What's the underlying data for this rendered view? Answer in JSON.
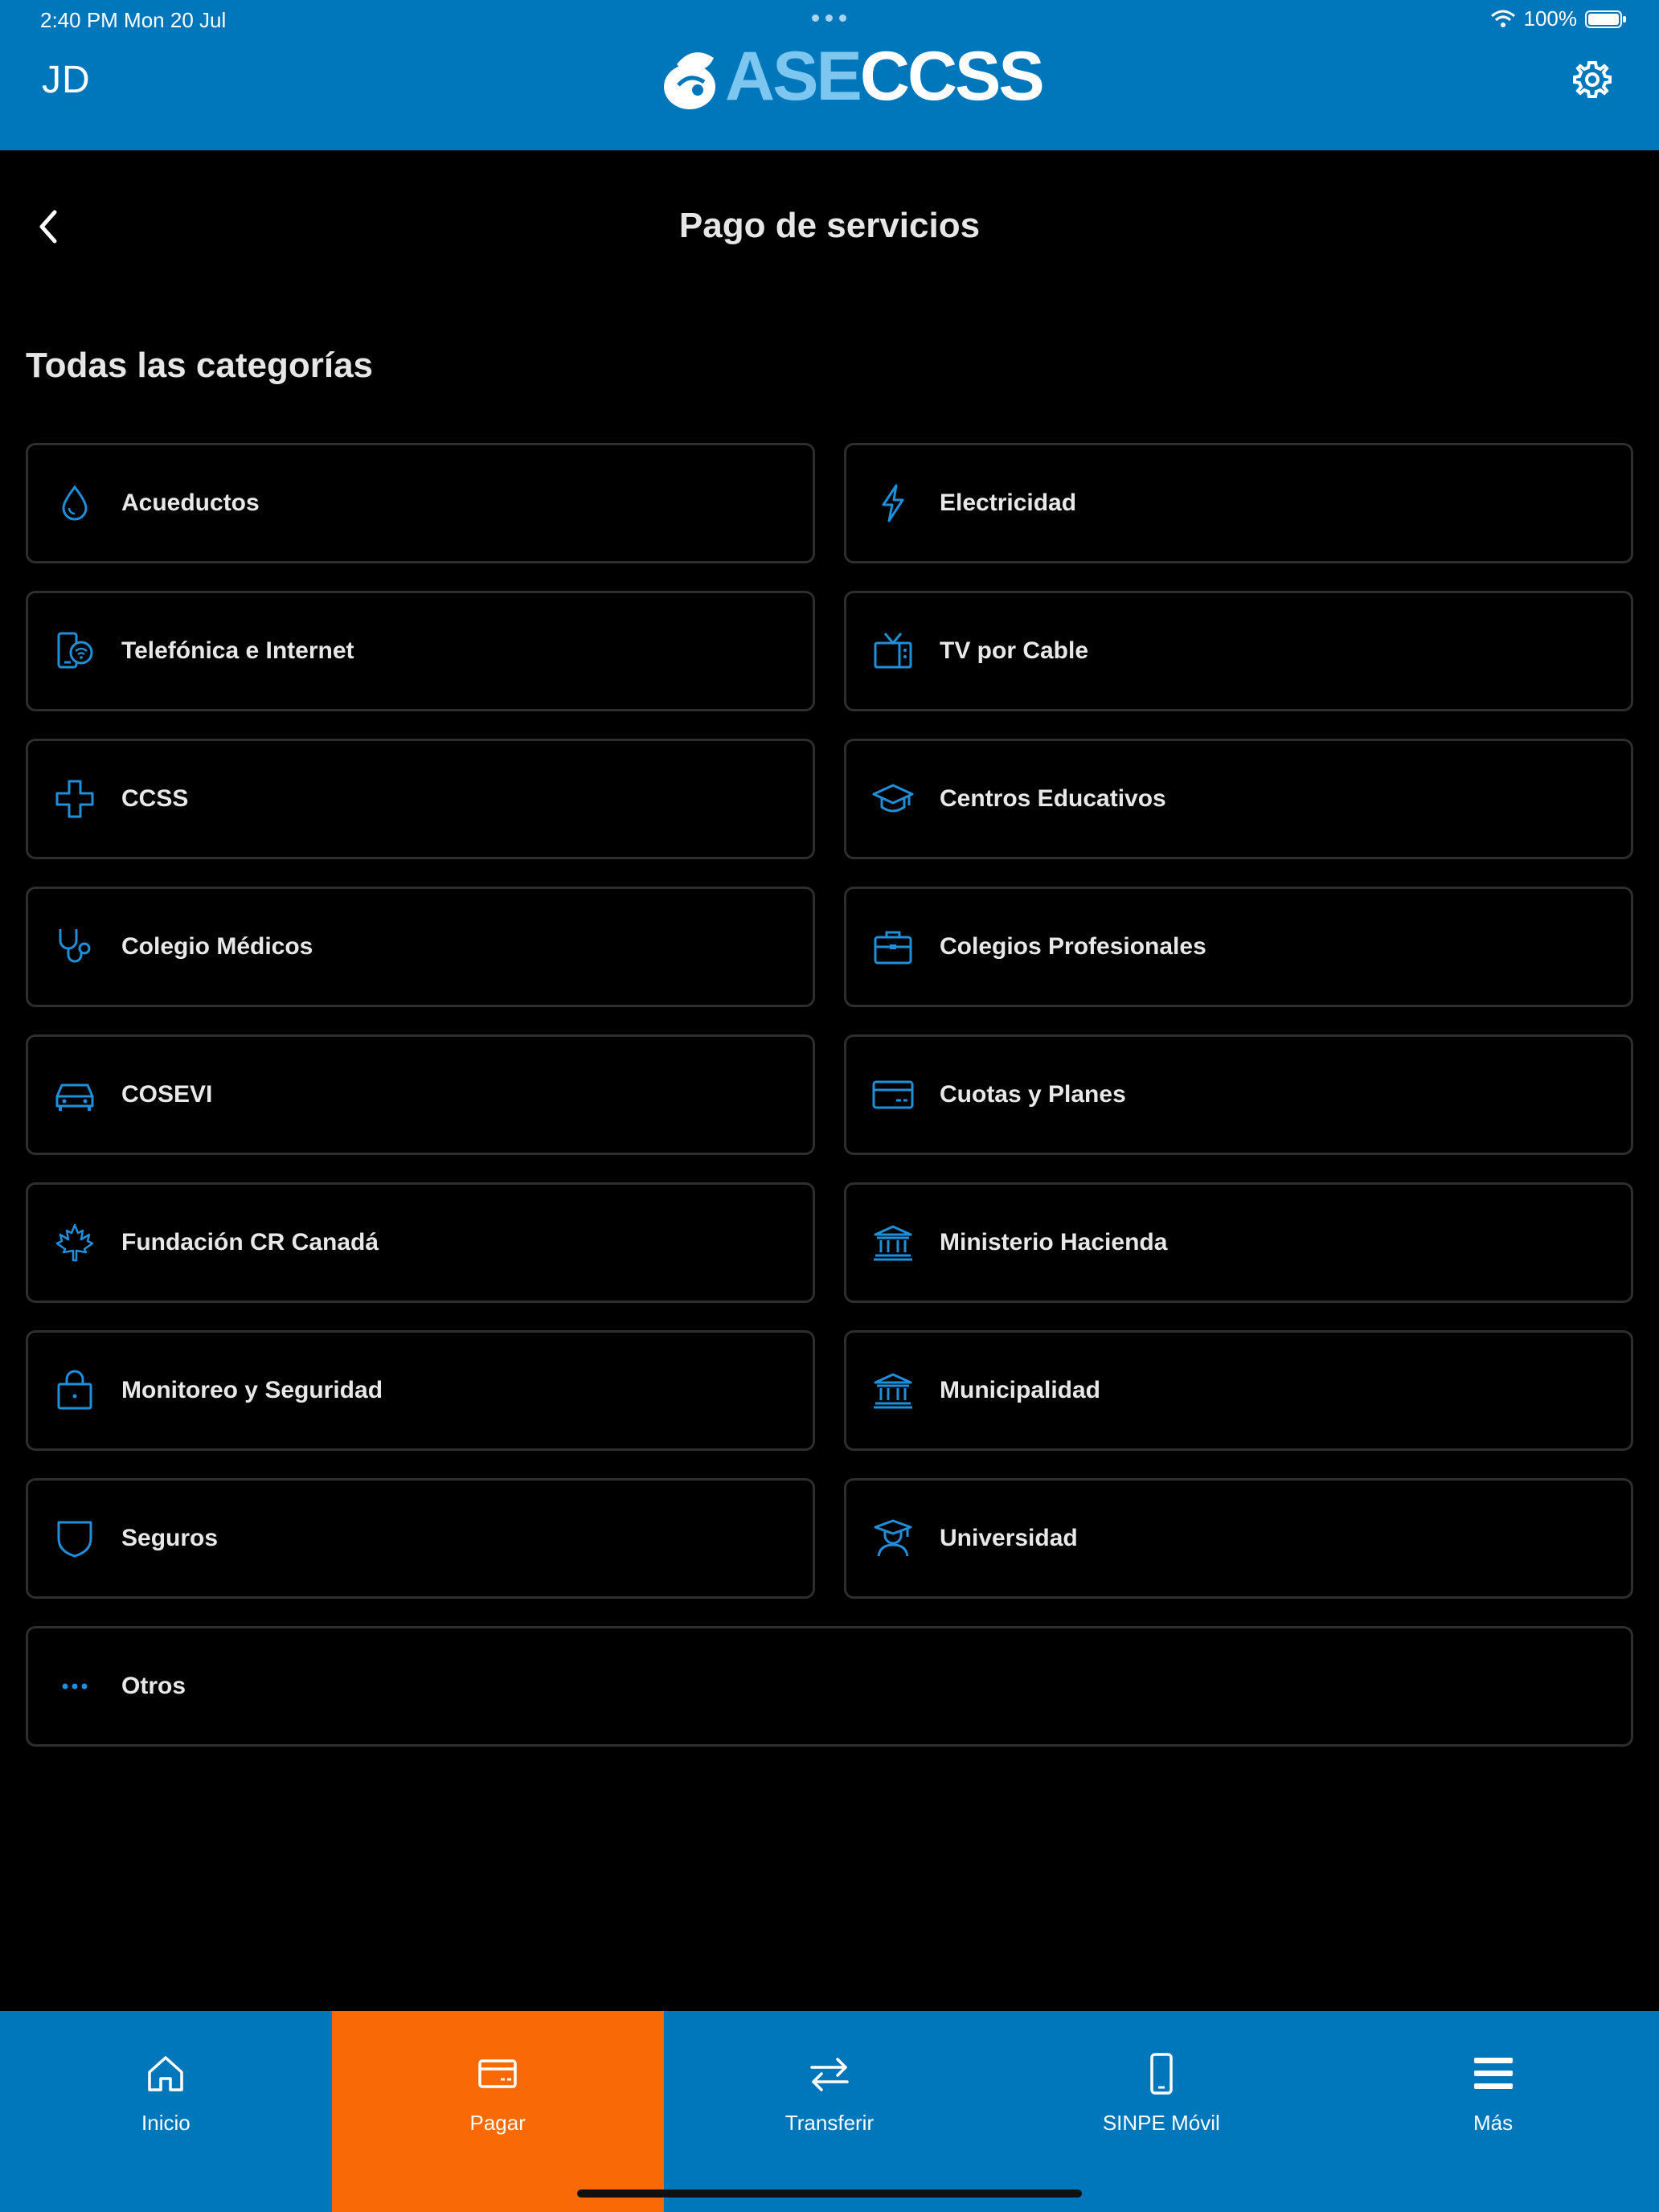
{
  "status_bar": {
    "time": "2:40 PM   Mon 20 Jul",
    "battery": "100%"
  },
  "header": {
    "avatar_initials": "JD",
    "logo_part1": "ASE",
    "logo_part2": "CCSS"
  },
  "title_bar": {
    "title": "Pago de servicios"
  },
  "section": {
    "title": "Todas las categorías"
  },
  "categories": [
    {
      "label": "Acueductos",
      "icon": "water-drop-icon"
    },
    {
      "label": "Electricidad",
      "icon": "lightning-icon"
    },
    {
      "label": "Telefónica e Internet",
      "icon": "phone-wifi-icon"
    },
    {
      "label": "TV por Cable",
      "icon": "tv-icon"
    },
    {
      "label": "CCSS",
      "icon": "medical-cross-icon"
    },
    {
      "label": "Centros Educativos",
      "icon": "graduation-cap-icon"
    },
    {
      "label": "Colegio Médicos",
      "icon": "stethoscope-icon"
    },
    {
      "label": "Colegios Profesionales",
      "icon": "briefcase-icon"
    },
    {
      "label": "COSEVI",
      "icon": "car-icon"
    },
    {
      "label": "Cuotas y Planes",
      "icon": "credit-card-icon"
    },
    {
      "label": "Fundación CR Canadá",
      "icon": "maple-leaf-icon"
    },
    {
      "label": "Ministerio Hacienda",
      "icon": "bank-icon"
    },
    {
      "label": "Monitoreo y Seguridad",
      "icon": "lock-bag-icon"
    },
    {
      "label": "Municipalidad",
      "icon": "bank-icon"
    },
    {
      "label": "Seguros",
      "icon": "shield-icon"
    },
    {
      "label": "Universidad",
      "icon": "graduate-icon"
    },
    {
      "label": "Otros",
      "icon": "more-dots-icon"
    }
  ],
  "bottom_nav": [
    {
      "label": "Inicio",
      "icon": "home-icon"
    },
    {
      "label": "Pagar",
      "icon": "card-icon"
    },
    {
      "label": "Transferir",
      "icon": "transfer-icon"
    },
    {
      "label": "SINPE Móvil",
      "icon": "mobile-icon"
    },
    {
      "label": "Más",
      "icon": "menu-icon"
    }
  ],
  "colors": {
    "brand_blue": "#0077bb",
    "active_orange": "#f96a06",
    "icon_blue": "#1f8fd9",
    "card_border": "#2e2e2e"
  }
}
